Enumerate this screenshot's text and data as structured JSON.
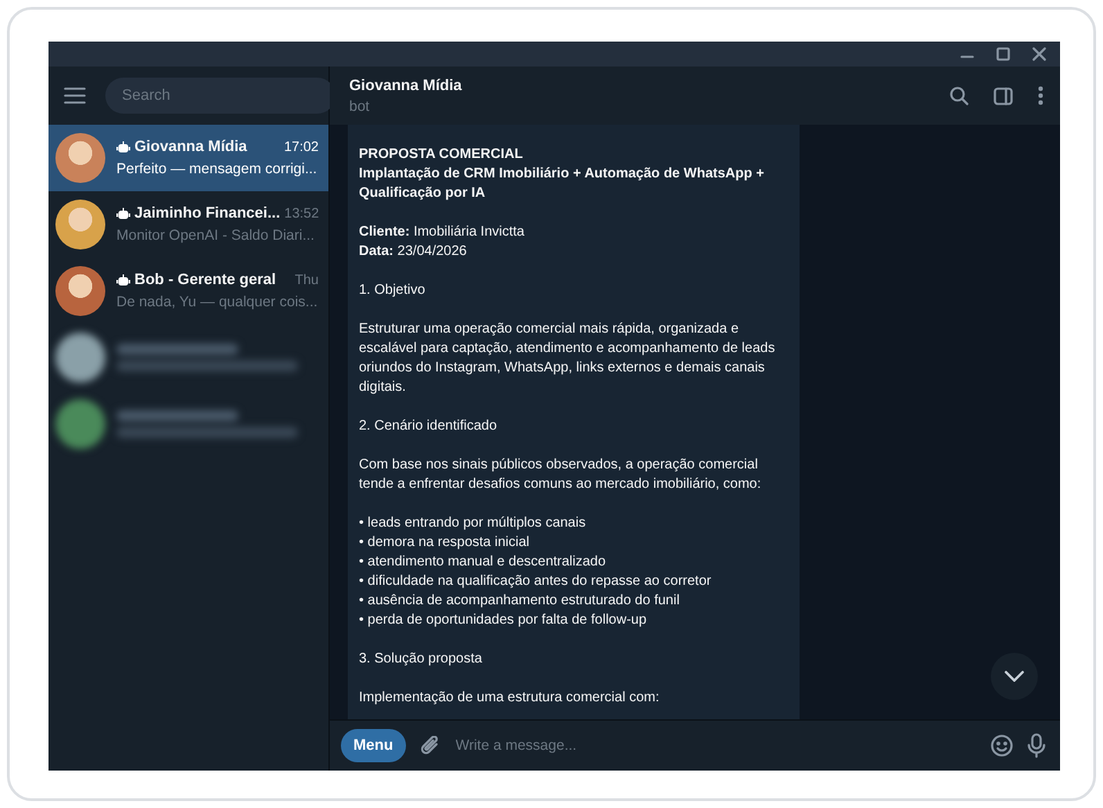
{
  "search": {
    "placeholder": "Search"
  },
  "chats": [
    {
      "kind": "chat",
      "name": "Giovanna Mídia",
      "time": "17:02",
      "preview": "Perfeito — mensagem corrigi...",
      "selected": true,
      "bot": true,
      "color": "#c9825a"
    },
    {
      "kind": "chat",
      "name": "Jaiminho Financei...",
      "time": "13:52",
      "preview": "Monitor OpenAI - Saldo Diari...",
      "selected": false,
      "bot": true,
      "color": "#d8a24a"
    },
    {
      "kind": "chat",
      "name": "Bob - Gerente geral",
      "time": "Thu",
      "preview": "De nada, Yu — qualquer cois...",
      "selected": false,
      "bot": true,
      "color": "#b8643e"
    },
    {
      "kind": "blurred",
      "color": "#8aa0a8"
    },
    {
      "kind": "blurred",
      "color": "#4a8a5a"
    }
  ],
  "header": {
    "title": "Giovanna Mídia",
    "status": "bot"
  },
  "message": {
    "paragraphs": [
      [
        "**PROPOSTA COMERCIAL**",
        "**Implantação de CRM Imobiliário + Automação de WhatsApp +**",
        "**Qualificação por IA**"
      ],
      [
        "**Cliente:** Imobiliária Invictta",
        "**Data:** 23/04/2026"
      ],
      [
        "1. Objetivo"
      ],
      [
        "Estruturar uma operação comercial mais rápida, organizada e",
        "escalável para captação, atendimento e acompanhamento de leads",
        "oriundos do Instagram, WhatsApp, links externos e demais canais",
        "digitais."
      ],
      [
        "2. Cenário identificado"
      ],
      [
        "Com base nos sinais públicos observados, a operação comercial",
        "tende a enfrentar desafios comuns ao mercado imobiliário, como:"
      ],
      [
        "• leads entrando por múltiplos canais",
        "• demora na resposta inicial",
        "• atendimento manual e descentralizado",
        "• dificuldade na qualificação antes do repasse ao corretor",
        "• ausência de acompanhamento estruturado do funil",
        "• perda de oportunidades por falta de follow-up"
      ],
      [
        "3. Solução proposta"
      ],
      [
        "Implementação de uma estrutura comercial com:"
      ]
    ]
  },
  "composer": {
    "menu": "Menu",
    "placeholder": "Write a message..."
  }
}
